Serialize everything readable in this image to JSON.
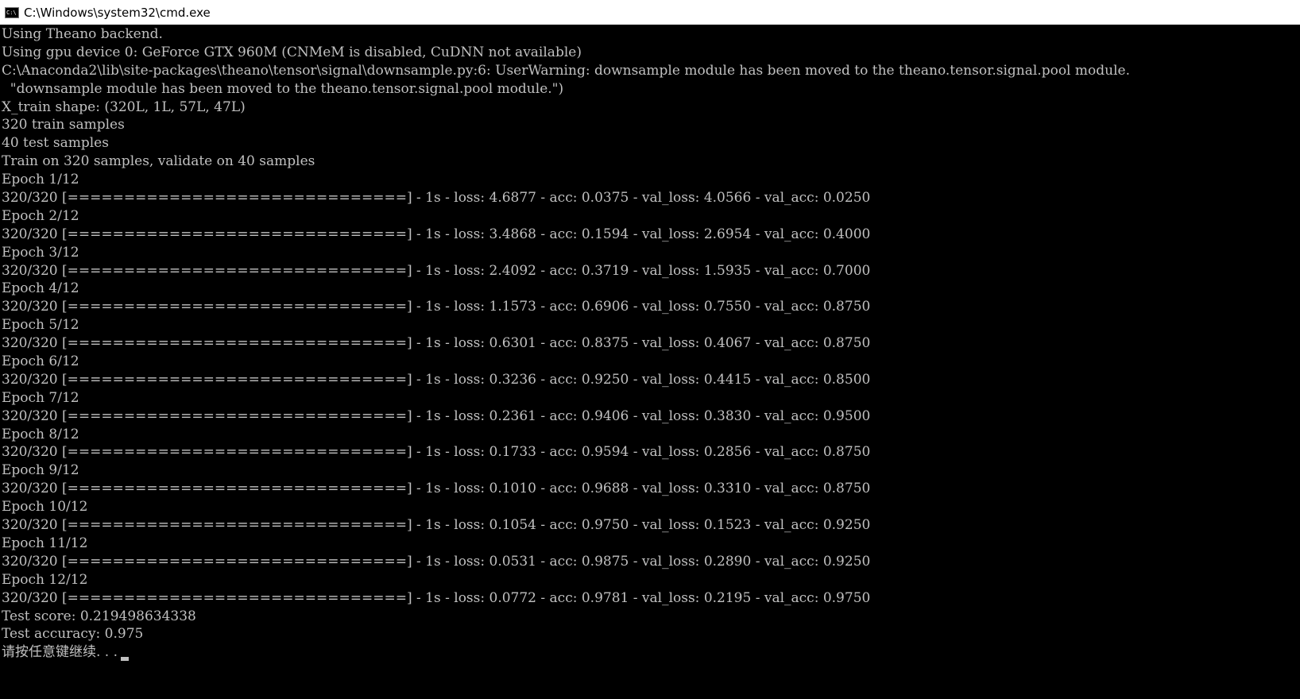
{
  "window": {
    "title": "C:\\Windows\\system32\\cmd.exe",
    "icon_name": "cmd-icon",
    "icon_glyph": "C:\\",
    "background_color": "#000000",
    "text_color": "#c0c0c0"
  },
  "console": {
    "lines": [
      "Using Theano backend.",
      "Using gpu device 0: GeForce GTX 960M (CNMeM is disabled, CuDNN not available)",
      "C:\\Anaconda2\\lib\\site-packages\\theano\\tensor\\signal\\downsample.py:6: UserWarning: downsample module has been moved to the theano.tensor.signal.pool module.",
      "  \"downsample module has been moved to the theano.tensor.signal.pool module.\")",
      "X_train shape: (320L, 1L, 57L, 47L)",
      "320 train samples",
      "40 test samples",
      "Train on 320 samples, validate on 40 samples",
      "Epoch 1/12",
      "320/320 [==============================] - 1s - loss: 4.6877 - acc: 0.0375 - val_loss: 4.0566 - val_acc: 0.0250",
      "Epoch 2/12",
      "320/320 [==============================] - 1s - loss: 3.4868 - acc: 0.1594 - val_loss: 2.6954 - val_acc: 0.4000",
      "Epoch 3/12",
      "320/320 [==============================] - 1s - loss: 2.4092 - acc: 0.3719 - val_loss: 1.5935 - val_acc: 0.7000",
      "Epoch 4/12",
      "320/320 [==============================] - 1s - loss: 1.1573 - acc: 0.6906 - val_loss: 0.7550 - val_acc: 0.8750",
      "Epoch 5/12",
      "320/320 [==============================] - 1s - loss: 0.6301 - acc: 0.8375 - val_loss: 0.4067 - val_acc: 0.8750",
      "Epoch 6/12",
      "320/320 [==============================] - 1s - loss: 0.3236 - acc: 0.9250 - val_loss: 0.4415 - val_acc: 0.8500",
      "Epoch 7/12",
      "320/320 [==============================] - 1s - loss: 0.2361 - acc: 0.9406 - val_loss: 0.3830 - val_acc: 0.9500",
      "Epoch 8/12",
      "320/320 [==============================] - 1s - loss: 0.1733 - acc: 0.9594 - val_loss: 0.2856 - val_acc: 0.8750",
      "Epoch 9/12",
      "320/320 [==============================] - 1s - loss: 0.1010 - acc: 0.9688 - val_loss: 0.3310 - val_acc: 0.8750",
      "Epoch 10/12",
      "320/320 [==============================] - 1s - loss: 0.1054 - acc: 0.9750 - val_loss: 0.1523 - val_acc: 0.9250",
      "Epoch 11/12",
      "320/320 [==============================] - 1s - loss: 0.0531 - acc: 0.9875 - val_loss: 0.2890 - val_acc: 0.9250",
      "Epoch 12/12",
      "320/320 [==============================] - 1s - loss: 0.0772 - acc: 0.9781 - val_loss: 0.2195 - val_acc: 0.9750",
      "Test score: 0.219498634338",
      "Test accuracy: 0.975"
    ],
    "prompt": "请按任意键继续. . ."
  }
}
